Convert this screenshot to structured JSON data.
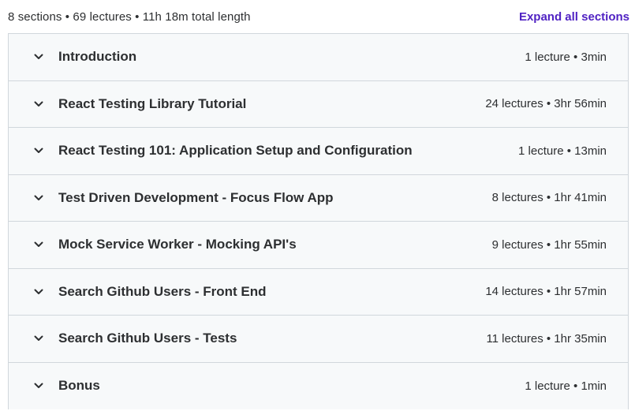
{
  "summary": {
    "text": "8 sections • 69 lectures • 11h 18m total length",
    "expand_label": "Expand all sections"
  },
  "sections": [
    {
      "title": "Introduction",
      "meta": "1 lecture • 3min"
    },
    {
      "title": "React Testing Library Tutorial",
      "meta": "24 lectures • 3hr 56min"
    },
    {
      "title": "React Testing 101: Application Setup and Configuration",
      "meta": "1 lecture • 13min"
    },
    {
      "title": "Test Driven Development - Focus Flow App",
      "meta": "8 lectures • 1hr 41min"
    },
    {
      "title": "Mock Service Worker - Mocking API's",
      "meta": "9 lectures • 1hr 55min"
    },
    {
      "title": "Search Github Users - Front End",
      "meta": "14 lectures • 1hr 57min"
    },
    {
      "title": "Search Github Users - Tests",
      "meta": "11 lectures • 1hr 35min"
    },
    {
      "title": "Bonus",
      "meta": "1 lecture • 1min"
    }
  ],
  "icons": {
    "section_toggle": "chevron-down-icon"
  },
  "colors": {
    "accent": "#5022c3",
    "row_background": "#f7f9fa",
    "border": "#d1d7dc",
    "text": "#2d2f31"
  }
}
